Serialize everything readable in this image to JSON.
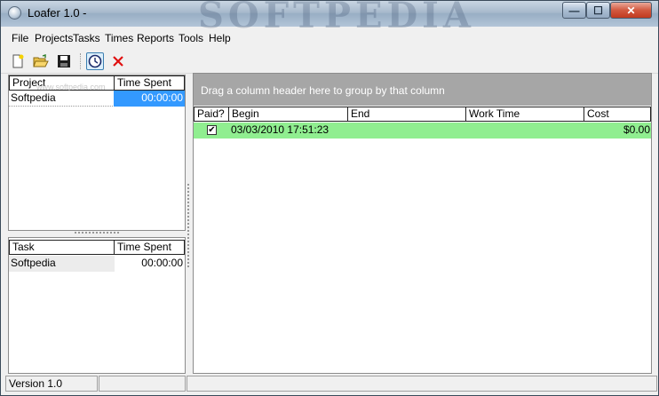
{
  "window": {
    "title": "Loafer 1.0 -",
    "watermark": "SOFTPEDIA"
  },
  "titlebar_buttons": {
    "minimize": "—",
    "maximize": "☐",
    "close": "✕"
  },
  "menu": [
    "File",
    "Projects",
    "Tasks",
    "Times",
    "Reports",
    "Tools",
    "Help"
  ],
  "toolbar": {
    "icons": [
      "new-document-icon",
      "open-folder-icon",
      "save-disk-icon",
      "clock-timer-icon",
      "delete-x-icon"
    ],
    "new_glyph": "🗋",
    "open_glyph": "📂",
    "save_glyph": "💾",
    "clock_glyph": "◷",
    "delete_glyph": "✕",
    "delete_color": "#e01010",
    "active_tool": "clock-timer-icon"
  },
  "projects_grid": {
    "headers": [
      "Project",
      "Time Spent"
    ],
    "rows": [
      {
        "name": "Softpedia",
        "time": "00:00:00"
      }
    ],
    "selected_color": "#3399ff",
    "row_watermark": "www.softpedia.com"
  },
  "tasks_grid": {
    "headers": [
      "Task",
      "Time Spent"
    ],
    "rows": [
      {
        "name": "Softpedia",
        "time": "00:00:00"
      }
    ]
  },
  "times_grid": {
    "group_hint": "Drag a column header here to group by that column",
    "headers": [
      "Paid?",
      "Begin",
      "End",
      "Work Time",
      "Cost"
    ],
    "rows": [
      {
        "paid": true,
        "paid_glyph": "✔",
        "begin": "03/03/2010 17:51:23",
        "end": "",
        "work_time": "",
        "cost": "$0.00"
      }
    ],
    "row_color": "#90ee90"
  },
  "status": {
    "version": "Version 1.0",
    "panel2": "",
    "panel3": ""
  }
}
